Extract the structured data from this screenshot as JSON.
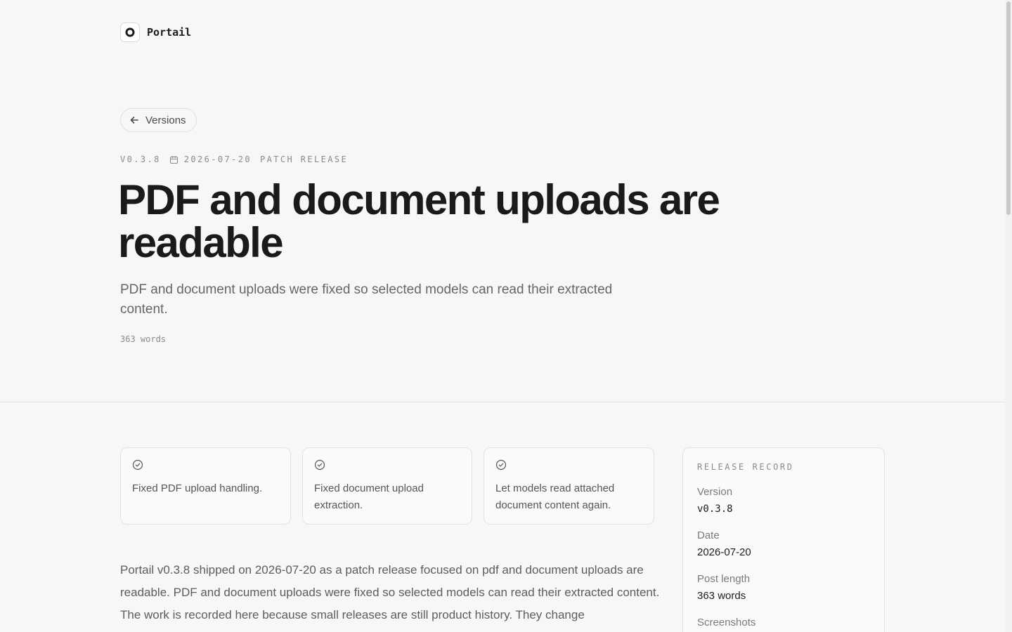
{
  "brand": {
    "name": "Portail",
    "logo_icon": "ring-logo-icon"
  },
  "nav": {
    "back_label": "Versions",
    "back_icon": "arrow-left-icon"
  },
  "meta": {
    "version": "V0.3.8",
    "date": "2026-07-20",
    "date_icon": "calendar-icon",
    "type": "PATCH RELEASE"
  },
  "title": "PDF and document uploads are readable",
  "subtitle": "PDF and document uploads were fixed so selected models can read their extracted content.",
  "word_count": "363 words",
  "highlights": [
    {
      "icon": "check-circle-icon",
      "text": "Fixed PDF upload handling."
    },
    {
      "icon": "check-circle-icon",
      "text": "Fixed document upload extraction."
    },
    {
      "icon": "check-circle-icon",
      "text": "Let models read attached document content again."
    }
  ],
  "body": "Portail v0.3.8 shipped on 2026-07-20 as a patch release focused on pdf and document uploads are readable. PDF and document uploads were fixed so selected models can read their extracted content. The work is recorded here because small releases are still product history. They change",
  "record": {
    "heading": "RELEASE RECORD",
    "rows": [
      {
        "label": "Version",
        "value": "v0.3.8"
      },
      {
        "label": "Date",
        "value": "2026-07-20"
      },
      {
        "label": "Post length",
        "value": "363 words"
      },
      {
        "label": "Screenshots",
        "value": ""
      }
    ]
  },
  "colors": {
    "background": "#f7f7f7",
    "text": "#1c1c1e",
    "muted": "#8a8a8f",
    "border": "#e2e2e2"
  }
}
